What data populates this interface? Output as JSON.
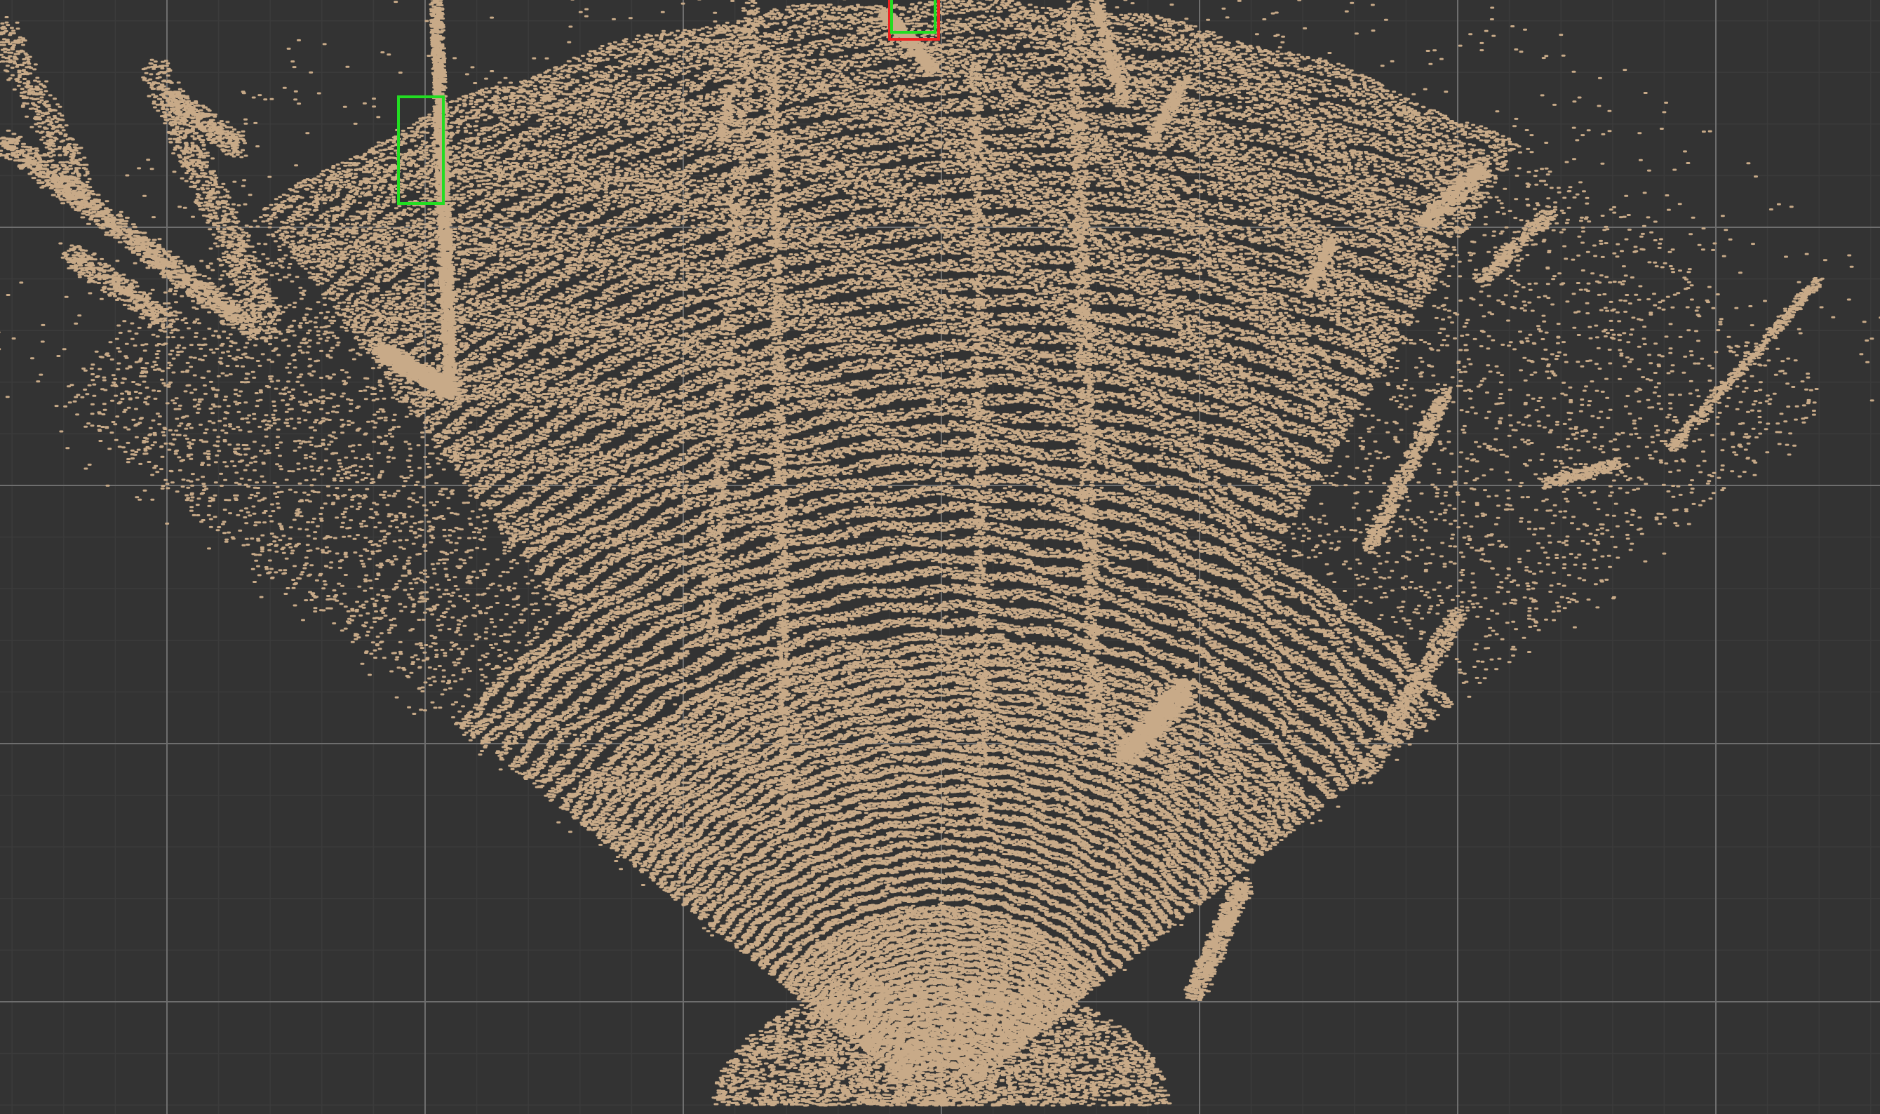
{
  "viewer": {
    "mode": "point-cloud-bev",
    "background_color": "#333333",
    "point_color": "#c8aa88",
    "minor_grid_color": "#3b3b3b",
    "major_grid_color": "#6e6e6e",
    "grid_visible": true,
    "detections": [
      {
        "label": "",
        "kind": "predicted",
        "color": "#22dd22"
      },
      {
        "label": "",
        "kind": "predicted",
        "color": "#22dd22"
      },
      {
        "label": "",
        "kind": "ground-truth",
        "color": "#ee2222"
      }
    ]
  }
}
